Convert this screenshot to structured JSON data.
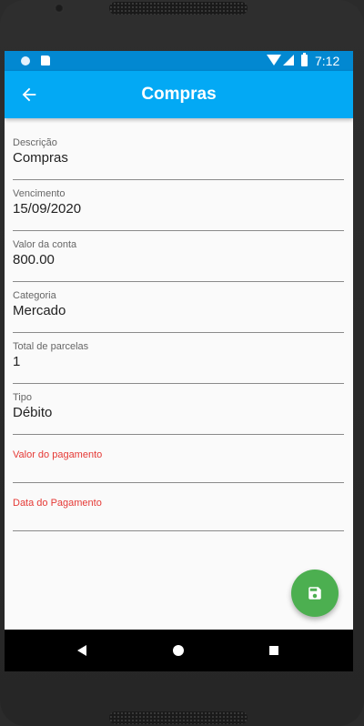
{
  "status_bar": {
    "time": "7:12"
  },
  "app_bar": {
    "title": "Compras",
    "back_icon": "arrow-back-icon"
  },
  "form": {
    "fields": [
      {
        "label": "Descrição",
        "value": "Compras"
      },
      {
        "label": "Vencimento",
        "value": "15/09/2020"
      },
      {
        "label": "Valor da conta",
        "value": "800.00"
      },
      {
        "label": "Categoria",
        "value": "Mercado"
      },
      {
        "label": "Total de parcelas",
        "value": "1"
      },
      {
        "label": "Tipo",
        "value": "Débito"
      }
    ],
    "empty_fields": [
      {
        "label": "Valor do pagamento",
        "value": ""
      },
      {
        "label": "Data do Pagamento",
        "value": ""
      }
    ]
  },
  "fab": {
    "icon": "save-icon",
    "color": "#4caf50"
  },
  "colors": {
    "app_bar": "#03a9f4",
    "status_bar": "#0288d1",
    "error_label": "#e53935"
  }
}
